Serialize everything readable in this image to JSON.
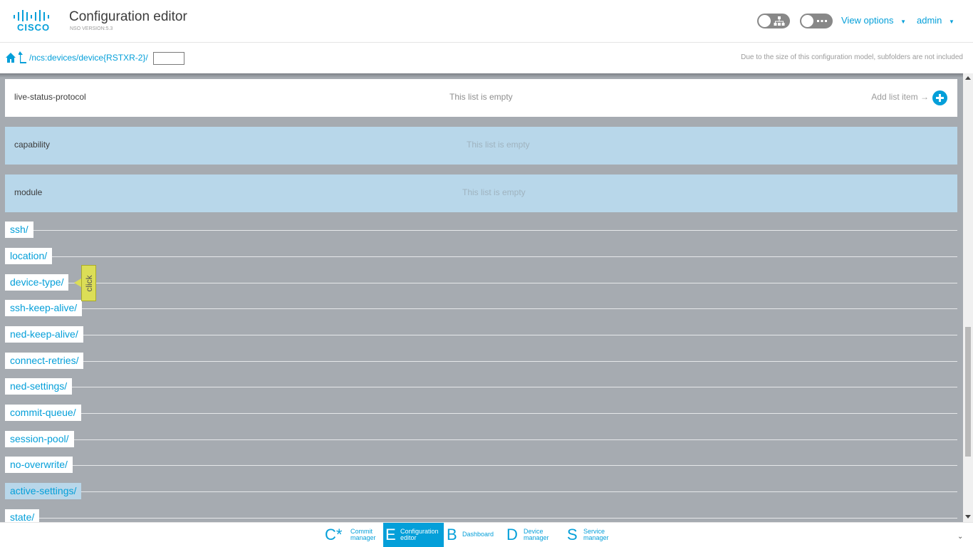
{
  "header": {
    "logo_text": "CISCO",
    "title": "Configuration editor",
    "version": "NSO VERSION:5.3",
    "view_options": "View options",
    "user": "admin"
  },
  "crumb": {
    "path": "/ncs:devices/device{RSTXR-2}/",
    "input_value": "",
    "note": "Due to the size of this configuration model, subfolders are not included"
  },
  "lists": [
    {
      "name": "live-status-protocol",
      "empty": "This list is empty",
      "add": "Add list item →"
    },
    {
      "name": "capability",
      "empty": "This list is empty"
    },
    {
      "name": "module",
      "empty": "This list is empty"
    }
  ],
  "folders": [
    "ssh/",
    "location/",
    "device-type/",
    "ssh-keep-alive/",
    "ned-keep-alive/",
    "connect-retries/",
    "ned-settings/",
    "commit-queue/",
    "session-pool/",
    "no-overwrite/",
    "active-settings/",
    "state/"
  ],
  "click_tag": "click",
  "nav": [
    {
      "letter": "C*",
      "label": "Commit\nmanager"
    },
    {
      "letter": "E",
      "label": "Configuration\neditor"
    },
    {
      "letter": "B",
      "label": "Dashboard"
    },
    {
      "letter": "D",
      "label": "Device\nmanager"
    },
    {
      "letter": "S",
      "label": "Service\nmanager"
    }
  ],
  "colors": {
    "accent": "#049fd9",
    "selected": "#b8d7ea",
    "background": "#a6abb1"
  }
}
